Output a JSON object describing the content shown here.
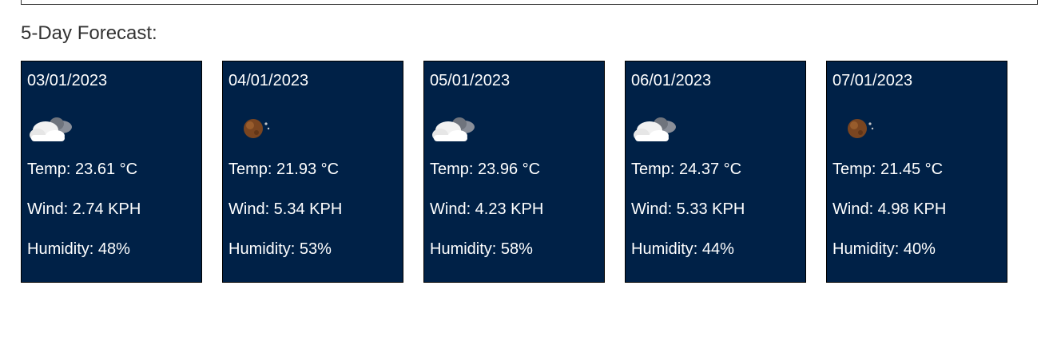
{
  "section": {
    "title": "5-Day Forecast:"
  },
  "forecast": [
    {
      "date": "03/01/2023",
      "icon": "cloud-night-icon",
      "temp": "Temp: 23.61 °C",
      "wind": "Wind: 2.74 KPH",
      "humidity": "Humidity: 48%"
    },
    {
      "date": "04/01/2023",
      "icon": "moon-icon",
      "temp": "Temp: 21.93 °C",
      "wind": "Wind: 5.34 KPH",
      "humidity": "Humidity: 53%"
    },
    {
      "date": "05/01/2023",
      "icon": "cloud-night-icon",
      "temp": "Temp: 23.96 °C",
      "wind": "Wind: 4.23 KPH",
      "humidity": "Humidity: 58%"
    },
    {
      "date": "06/01/2023",
      "icon": "cloud-night-icon",
      "temp": "Temp: 24.37 °C",
      "wind": "Wind: 5.33 KPH",
      "humidity": "Humidity: 44%"
    },
    {
      "date": "07/01/2023",
      "icon": "moon-icon",
      "temp": "Temp: 21.45 °C",
      "wind": "Wind: 4.98 KPH",
      "humidity": "Humidity: 40%"
    }
  ],
  "colors": {
    "card_background": "#002147",
    "card_text": "#ffffff"
  }
}
